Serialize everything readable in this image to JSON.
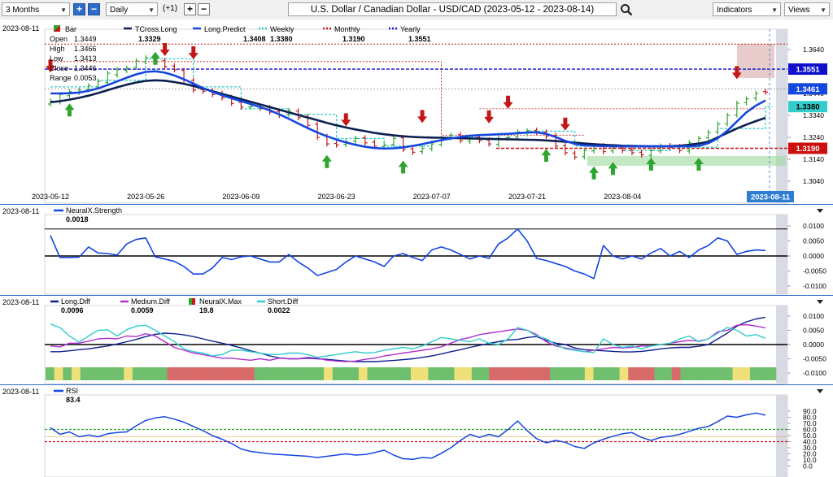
{
  "toolbar": {
    "period": "3 Months",
    "interval": "Daily",
    "offset": "(+1)",
    "title": "U.S. Dollar / Canadian Dollar - USD/CAD (2023-05-12 - 2023-08-14)",
    "indicators": "Indicators",
    "views": "Views",
    "plus": "+",
    "minus": "−"
  },
  "colors": {
    "bull": "#2fa52f",
    "bear": "#c41818",
    "tcross": "#0d1f4f",
    "predict": "#1446e0",
    "weekly": "#33cccc",
    "monthly": "#cc1010",
    "yearly": "#1010cc"
  },
  "chart_data": [
    {
      "type": "candlestick",
      "panel": "price",
      "date_label": "2023-08-11",
      "legend": [
        {
          "name": "Bar",
          "value": ""
        },
        {
          "name": "TCross.Long",
          "value": "1.3329"
        },
        {
          "name": "Long.Predict",
          "value": "1.3408"
        },
        {
          "name": "Weekly",
          "value": "1.3380"
        },
        {
          "name": "Monthly",
          "value": "1.3190"
        },
        {
          "name": "Yearly",
          "value": "1.3551"
        }
      ],
      "ohlc_info": [
        {
          "label": "Open",
          "value": "1.3449"
        },
        {
          "label": "High",
          "value": "1.3466"
        },
        {
          "label": "Low",
          "value": "1.3413"
        },
        {
          "label": "Close",
          "value": "1.3446"
        },
        {
          "label": "Range",
          "value": "0.0053"
        }
      ],
      "ylim": [
        1.3045,
        1.3675
      ],
      "y_ticks": [
        "1.3640",
        "1.3540",
        "1.3440",
        "1.3340",
        "1.3240",
        "1.3140",
        "1.3040"
      ],
      "x_ticks": [
        "2023-05-12",
        "2023-05-26",
        "2023-06-09",
        "2023-06-23",
        "2023-07-07",
        "2023-07-21",
        "2023-08-04"
      ],
      "badges": [
        "1.3551",
        "1.3461",
        "1.3380",
        "1.3190"
      ],
      "current_date": "2023-08-11",
      "close": [
        1.3405,
        1.3435,
        1.3448,
        1.3455,
        1.3475,
        1.3495,
        1.3532,
        1.3548,
        1.3555,
        1.3588,
        1.3602,
        1.3585,
        1.3562,
        1.3548,
        1.35,
        1.3455,
        1.345,
        1.3435,
        1.342,
        1.3395,
        1.3378,
        1.338,
        1.3372,
        1.3355,
        1.334,
        1.3362,
        1.333,
        1.3295,
        1.324,
        1.321,
        1.3205,
        1.322,
        1.3235,
        1.3215,
        1.32,
        1.3205,
        1.3235,
        1.3185,
        1.3172,
        1.319,
        1.321,
        1.3235,
        1.325,
        1.3225,
        1.3238,
        1.3225,
        1.321,
        1.3235,
        1.324,
        1.3265,
        1.327,
        1.3262,
        1.3245,
        1.32,
        1.317,
        1.315,
        1.318,
        1.32,
        1.3175,
        1.3195,
        1.318,
        1.317,
        1.316,
        1.318,
        1.32,
        1.3195,
        1.318,
        1.3215,
        1.3235,
        1.3262,
        1.33,
        1.334,
        1.3395,
        1.3415,
        1.344,
        1.3446
      ],
      "open": [
        1.3392,
        1.3402,
        1.343,
        1.3445,
        1.3458,
        1.347,
        1.349,
        1.3525,
        1.3545,
        1.356,
        1.3585,
        1.3602,
        1.359,
        1.3565,
        1.3545,
        1.35,
        1.3458,
        1.3452,
        1.344,
        1.3422,
        1.34,
        1.3378,
        1.3382,
        1.3375,
        1.3358,
        1.3345,
        1.336,
        1.3335,
        1.33,
        1.3245,
        1.3212,
        1.3208,
        1.3222,
        1.3238,
        1.3218,
        1.3198,
        1.3208,
        1.3238,
        1.3188,
        1.3175,
        1.3188,
        1.3208,
        1.3238,
        1.3252,
        1.3222,
        1.324,
        1.3228,
        1.3208,
        1.3238,
        1.3242,
        1.3262,
        1.3272,
        1.3264,
        1.3248,
        1.3202,
        1.3168,
        1.3152,
        1.3178,
        1.3202,
        1.3178,
        1.3192,
        1.3182,
        1.3172,
        1.3158,
        1.3178,
        1.3202,
        1.3198,
        1.3178,
        1.3212,
        1.3238,
        1.3265,
        1.3302,
        1.3342,
        1.3398,
        1.3418,
        1.3449
      ],
      "tcross_long": [
        1.34,
        1.3405,
        1.3412,
        1.342,
        1.343,
        1.3442,
        1.3455,
        1.3468,
        1.348,
        1.349,
        1.3497,
        1.35,
        1.3498,
        1.3492,
        1.3484,
        1.3474,
        1.3462,
        1.345,
        1.3438,
        1.3426,
        1.3414,
        1.3402,
        1.339,
        1.3378,
        1.3366,
        1.3354,
        1.3342,
        1.333,
        1.3318,
        1.3306,
        1.3295,
        1.3285,
        1.3276,
        1.3268,
        1.326,
        1.3254,
        1.3249,
        1.3245,
        1.3242,
        1.324,
        1.3239,
        1.3238,
        1.3237,
        1.3236,
        1.3235,
        1.3234,
        1.3233,
        1.3232,
        1.3231,
        1.323,
        1.3229,
        1.3228,
        1.3226,
        1.3223,
        1.322,
        1.3216,
        1.3212,
        1.3209,
        1.3206,
        1.3204,
        1.3202,
        1.3201,
        1.32,
        1.3199,
        1.3199,
        1.32,
        1.3202,
        1.3206,
        1.3212,
        1.322,
        1.324,
        1.326,
        1.328,
        1.3298,
        1.3314,
        1.3329
      ],
      "long_predict": [
        1.344,
        1.344,
        1.3441,
        1.3444,
        1.3452,
        1.3463,
        1.3478,
        1.3495,
        1.3512,
        1.3527,
        1.3538,
        1.3541,
        1.3535,
        1.3522,
        1.3505,
        1.3485,
        1.3465,
        1.3447,
        1.3432,
        1.3418,
        1.3405,
        1.3392,
        1.3378,
        1.3363,
        1.3345,
        1.3325,
        1.3303,
        1.3282,
        1.3262,
        1.3245,
        1.323,
        1.3217,
        1.3206,
        1.3197,
        1.3191,
        1.3189,
        1.319,
        1.3194,
        1.3201,
        1.3209,
        1.3218,
        1.3227,
        1.3235,
        1.3242,
        1.3247,
        1.325,
        1.3252,
        1.3254,
        1.3256,
        1.3259,
        1.3262,
        1.3263,
        1.3256,
        1.3241,
        1.3224,
        1.321,
        1.3203,
        1.3201,
        1.32,
        1.3199,
        1.3199,
        1.3199,
        1.3199,
        1.3199,
        1.3199,
        1.3199,
        1.3199,
        1.3199,
        1.3201,
        1.3213,
        1.3236,
        1.327,
        1.3312,
        1.3354,
        1.3385,
        1.3408
      ],
      "weekly_level": 1.338,
      "monthly_level": 1.319,
      "yearly_level": 1.3551
    },
    {
      "type": "line",
      "panel": "neuralx-strength",
      "date_label": "2023-08-11",
      "legend": [
        {
          "name": "NeuralX.Strength",
          "value": "0.0018"
        }
      ],
      "ylim": [
        -0.0115,
        0.0125
      ],
      "y_ticks": [
        "0.0100",
        "0.0050",
        "0.0000",
        "-0.0050",
        "-0.0100"
      ],
      "reference_line": 0.009,
      "values": [
        0.0068,
        -0.0005,
        -0.0005,
        -0.0004,
        0.003,
        0.001,
        0.0008,
        0.0003,
        0.004,
        0.0055,
        0.006,
        -0.0003,
        -0.001,
        -0.0018,
        -0.0035,
        -0.006,
        -0.006,
        -0.004,
        -0.0005,
        -0.0012,
        -0.0003,
        0.0,
        -0.001,
        -0.002,
        -0.002,
        0.0005,
        -0.002,
        -0.004,
        -0.0065,
        -0.0055,
        -0.0045,
        -0.002,
        0.0,
        -0.001,
        -0.002,
        -0.0035,
        0.0,
        0.0008,
        -0.0005,
        -0.0015,
        0.002,
        0.003,
        0.002,
        0.0005,
        -0.001,
        0.0,
        -0.0008,
        0.004,
        0.006,
        0.009,
        0.005,
        -0.0008,
        -0.0015,
        -0.0025,
        -0.0035,
        -0.005,
        -0.006,
        -0.0075,
        0.0035,
        0.0,
        -0.001,
        0.0,
        -0.001,
        0.001,
        0.0025,
        0.0,
        0.0015,
        -0.0005,
        0.002,
        0.0035,
        0.006,
        0.005,
        0.0005,
        0.0015,
        0.002,
        0.0018
      ]
    },
    {
      "type": "line",
      "panel": "diff",
      "date_label": "2023-08-11",
      "legend": [
        {
          "name": "Long.Diff",
          "value": "0.0096"
        },
        {
          "name": "Medium.Diff",
          "value": "0.0059"
        },
        {
          "name": "NeuralX.Max",
          "value": "19.8"
        },
        {
          "name": "Short.Diff",
          "value": "0.0022"
        }
      ],
      "ylim": [
        -0.0125,
        0.0125
      ],
      "y_ticks": [
        "0.0100",
        "0.0050",
        "0.0000",
        "-0.0050",
        "-0.0100"
      ],
      "series": [
        {
          "name": "Long.Diff",
          "values": [
            -0.0025,
            -0.0025,
            -0.0022,
            -0.0018,
            -0.0015,
            -0.001,
            -0.0005,
            0.0002,
            0.001,
            0.0018,
            0.0028,
            0.0036,
            0.004,
            0.0038,
            0.0034,
            0.0028,
            0.002,
            0.0012,
            0.0005,
            -0.0003,
            -0.0012,
            -0.0022,
            -0.003,
            -0.004,
            -0.0047,
            -0.005,
            -0.005,
            -0.0048,
            -0.005,
            -0.0052,
            -0.0055,
            -0.0058,
            -0.006,
            -0.006,
            -0.006,
            -0.0058,
            -0.0056,
            -0.0053,
            -0.005,
            -0.0045,
            -0.004,
            -0.0033,
            -0.0025,
            -0.0018,
            -0.001,
            -0.0003,
            0.0004,
            0.001,
            0.0016,
            0.0018,
            0.0025,
            0.0028,
            0.0015,
            0.0005,
            0.0,
            -0.0012,
            -0.0018,
            -0.002,
            -0.0022,
            -0.0024,
            -0.0026,
            -0.0026,
            -0.0024,
            -0.002,
            -0.0015,
            -0.0012,
            -0.001,
            -0.001,
            -0.0006,
            0.0,
            0.002,
            0.004,
            0.0065,
            0.008,
            0.009,
            0.0096
          ]
        },
        {
          "name": "Medium.Diff",
          "values": [
            -0.0005,
            -0.0008,
            0.0005,
            0.0005,
            0.0012,
            0.002,
            0.0022,
            0.002,
            0.003,
            0.0028,
            0.0038,
            0.003,
            0.001,
            -0.001,
            -0.002,
            -0.003,
            -0.0035,
            -0.0042,
            -0.0048,
            -0.0048,
            -0.0052,
            -0.0055,
            -0.005,
            -0.0055,
            -0.0048,
            -0.005,
            -0.005,
            -0.0045,
            -0.0048,
            -0.0055,
            -0.0058,
            -0.006,
            -0.0058,
            -0.0052,
            -0.0048,
            -0.004,
            -0.0035,
            -0.003,
            -0.0025,
            -0.002,
            -0.0015,
            -0.0008,
            0.0005,
            0.0018,
            0.0025,
            0.0035,
            0.004,
            0.0045,
            0.005,
            0.0055,
            0.005,
            0.0035,
            0.001,
            -0.0005,
            -0.0012,
            -0.0018,
            -0.0025,
            -0.002,
            -0.0015,
            -0.001,
            -0.0012,
            -0.001,
            -0.0005,
            -0.0005,
            0.0,
            0.0005,
            0.001,
            0.0015,
            0.0012,
            0.002,
            0.0045,
            0.005,
            0.0068,
            0.007,
            0.0065,
            0.0059
          ]
        },
        {
          "name": "Short.Diff",
          "values": [
            0.0072,
            0.006,
            0.003,
            0.0008,
            0.003,
            0.005,
            0.0052,
            0.003,
            0.0052,
            0.0065,
            0.0068,
            0.005,
            0.003,
            0.001,
            -0.0015,
            -0.0025,
            -0.003,
            -0.004,
            -0.0035,
            -0.002,
            -0.002,
            -0.0025,
            -0.003,
            -0.0035,
            -0.0035,
            -0.003,
            -0.003,
            -0.0035,
            -0.0045,
            -0.004,
            -0.0035,
            -0.003,
            -0.0025,
            -0.003,
            -0.0028,
            -0.002,
            -0.0015,
            -0.001,
            -0.0015,
            -0.0005,
            0.001,
            0.0025,
            0.002,
            0.0015,
            0.001,
            0.002,
            0.0005,
            0.0,
            0.002,
            0.006,
            0.005,
            0.003,
            0.002,
            0.0,
            -0.0015,
            -0.002,
            -0.0025,
            -0.0028,
            0.002,
            0.0,
            -0.001,
            -0.0005,
            -0.0015,
            -0.0005,
            0.0,
            0.0005,
            0.002,
            0.003,
            0.001,
            0.002,
            0.004,
            0.006,
            0.005,
            0.003,
            0.0035,
            0.0022
          ]
        }
      ],
      "neuralx_max_bars": [
        "g",
        "y",
        "g",
        "y",
        "g",
        "g",
        "g",
        "g",
        "g",
        "y",
        "g",
        "g",
        "g",
        "g",
        "r",
        "r",
        "r",
        "r",
        "r",
        "r",
        "r",
        "r",
        "r",
        "r",
        "g",
        "g",
        "g",
        "g",
        "g",
        "g",
        "g",
        "g",
        "y",
        "g",
        "g",
        "g",
        "y",
        "g",
        "g",
        "g",
        "g",
        "g",
        "y",
        "y",
        "g",
        "g",
        "g",
        "y",
        "y",
        "g",
        "g",
        "r",
        "r",
        "r",
        "r",
        "r",
        "r",
        "r",
        "g",
        "g",
        "g",
        "g",
        "y",
        "g",
        "g",
        "g",
        "y",
        "r",
        "r",
        "r",
        "g",
        "g",
        "r",
        "g",
        "g",
        "g",
        "g",
        "g",
        "g",
        "y",
        "y",
        "g",
        "g",
        "g"
      ]
    },
    {
      "type": "line",
      "panel": "rsi",
      "date_label": "2023-08-11",
      "legend": [
        {
          "name": "RSI",
          "value": "83.4"
        }
      ],
      "ylim": [
        0,
        100
      ],
      "y_ticks": [
        "90.0",
        "80.0",
        "70.0",
        "60.0",
        "50.0",
        "40.0",
        "30.0",
        "20.0",
        "10.0",
        "0.0"
      ],
      "overbought": 60,
      "oversold": 40,
      "values": [
        63,
        52,
        56,
        48,
        51,
        48,
        53,
        55,
        56,
        66,
        75,
        79,
        81,
        77,
        72,
        65,
        58,
        50,
        44,
        37,
        28,
        24,
        22,
        20,
        19,
        18,
        17,
        16,
        14,
        16,
        18,
        20,
        18,
        19,
        22,
        26,
        18,
        12,
        11,
        14,
        13,
        21,
        30,
        42,
        52,
        47,
        52,
        48,
        60,
        74,
        58,
        45,
        38,
        42,
        39,
        32,
        29,
        38,
        44,
        49,
        53,
        55,
        47,
        42,
        47,
        49,
        52,
        57,
        62,
        65,
        73,
        82,
        80,
        84,
        87,
        83.4
      ]
    }
  ]
}
